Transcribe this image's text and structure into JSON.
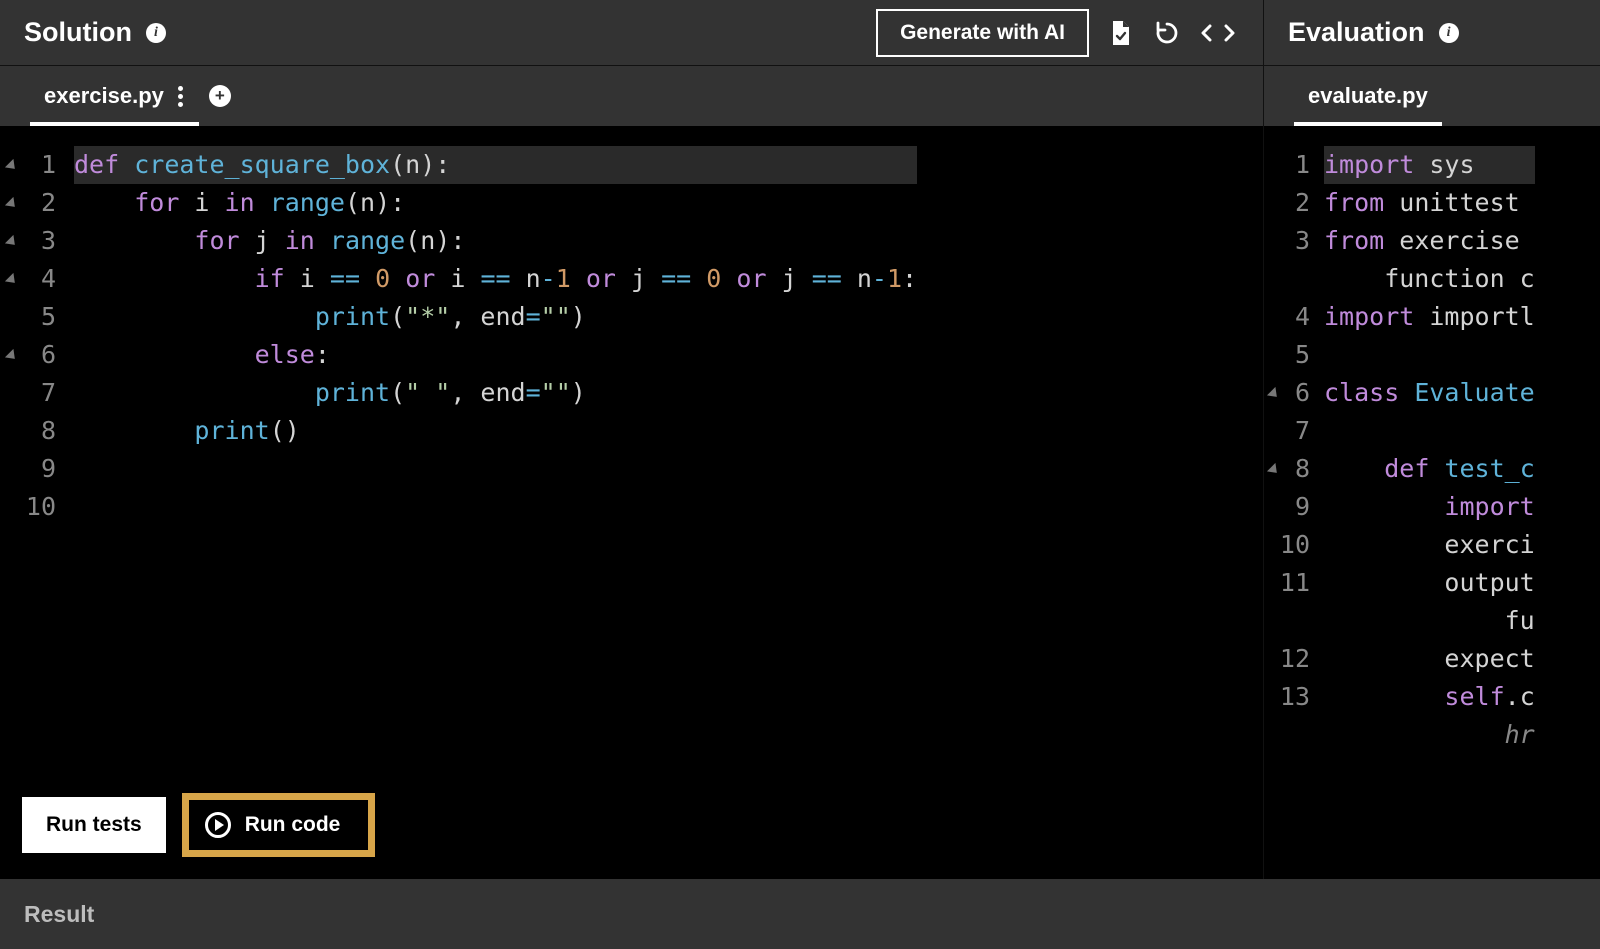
{
  "leftPanel": {
    "title": "Solution",
    "actions": {
      "generate": "Generate with AI"
    },
    "tab": "exercise.py"
  },
  "rightPanel": {
    "title": "Evaluation",
    "tab": "evaluate.py"
  },
  "buttons": {
    "runTests": "Run tests",
    "runCode": "Run code"
  },
  "result": {
    "title": "Result"
  },
  "leftCode": {
    "lines": [
      {
        "n": "1",
        "fold": true,
        "hl": true,
        "tokens": [
          [
            "kw",
            "def"
          ],
          [
            "pl",
            " "
          ],
          [
            "fn",
            "create_square_box"
          ],
          [
            "pn",
            "("
          ],
          [
            "pl",
            "n"
          ],
          [
            "pn",
            ")"
          ],
          [
            "pn",
            ":"
          ]
        ]
      },
      {
        "n": "2",
        "fold": true,
        "tokens": [
          [
            "pl",
            "    "
          ],
          [
            "kw",
            "for"
          ],
          [
            "pl",
            " i "
          ],
          [
            "kw",
            "in"
          ],
          [
            "pl",
            " "
          ],
          [
            "fn",
            "range"
          ],
          [
            "pn",
            "("
          ],
          [
            "pl",
            "n"
          ],
          [
            "pn",
            ")"
          ],
          [
            "pn",
            ":"
          ]
        ]
      },
      {
        "n": "3",
        "fold": true,
        "tokens": [
          [
            "pl",
            "        "
          ],
          [
            "kw",
            "for"
          ],
          [
            "pl",
            " j "
          ],
          [
            "kw",
            "in"
          ],
          [
            "pl",
            " "
          ],
          [
            "fn",
            "range"
          ],
          [
            "pn",
            "("
          ],
          [
            "pl",
            "n"
          ],
          [
            "pn",
            ")"
          ],
          [
            "pn",
            ":"
          ]
        ]
      },
      {
        "n": "4",
        "fold": true,
        "tokens": [
          [
            "pl",
            "            "
          ],
          [
            "kw",
            "if"
          ],
          [
            "pl",
            " i "
          ],
          [
            "op",
            "=="
          ],
          [
            "pl",
            " "
          ],
          [
            "num",
            "0"
          ],
          [
            "pl",
            " "
          ],
          [
            "kw",
            "or"
          ],
          [
            "pl",
            " i "
          ],
          [
            "op",
            "=="
          ],
          [
            "pl",
            " n"
          ],
          [
            "op",
            "-"
          ],
          [
            "num",
            "1"
          ],
          [
            "pl",
            " "
          ],
          [
            "kw",
            "or"
          ],
          [
            "pl",
            " j "
          ],
          [
            "op",
            "=="
          ],
          [
            "pl",
            " "
          ],
          [
            "num",
            "0"
          ],
          [
            "pl",
            " "
          ],
          [
            "kw",
            "or"
          ],
          [
            "pl",
            " j "
          ],
          [
            "op",
            "=="
          ],
          [
            "pl",
            " n"
          ],
          [
            "op",
            "-"
          ],
          [
            "num",
            "1"
          ],
          [
            "pn",
            ":"
          ]
        ]
      },
      {
        "n": "5",
        "tokens": [
          [
            "pl",
            "                "
          ],
          [
            "fn",
            "print"
          ],
          [
            "pn",
            "("
          ],
          [
            "str",
            "\"*\""
          ],
          [
            "pn",
            ","
          ],
          [
            "pl",
            " end"
          ],
          [
            "op",
            "="
          ],
          [
            "str",
            "\"\""
          ],
          [
            "pn",
            ")"
          ]
        ]
      },
      {
        "n": "6",
        "fold": true,
        "tokens": [
          [
            "pl",
            "            "
          ],
          [
            "kw",
            "else"
          ],
          [
            "pn",
            ":"
          ]
        ]
      },
      {
        "n": "7",
        "tokens": [
          [
            "pl",
            "                "
          ],
          [
            "fn",
            "print"
          ],
          [
            "pn",
            "("
          ],
          [
            "str",
            "\" \""
          ],
          [
            "pn",
            ","
          ],
          [
            "pl",
            " end"
          ],
          [
            "op",
            "="
          ],
          [
            "str",
            "\"\""
          ],
          [
            "pn",
            ")"
          ]
        ]
      },
      {
        "n": "8",
        "tokens": [
          [
            "pl",
            "        "
          ],
          [
            "fn",
            "print"
          ],
          [
            "pn",
            "("
          ],
          [
            "pn",
            ")"
          ]
        ]
      },
      {
        "n": "9",
        "tokens": []
      },
      {
        "n": "10",
        "tokens": []
      }
    ]
  },
  "rightCode": {
    "lines": [
      {
        "n": "1",
        "hl": true,
        "tokens": [
          [
            "kw",
            "import"
          ],
          [
            "pl",
            " sys"
          ]
        ]
      },
      {
        "n": "2",
        "tokens": [
          [
            "kw",
            "from"
          ],
          [
            "pl",
            " unittest"
          ]
        ]
      },
      {
        "n": "3",
        "tokens": [
          [
            "kw",
            "from"
          ],
          [
            "pl",
            " exercise"
          ]
        ]
      },
      {
        "n": "",
        "tokens": [
          [
            "pl",
            "    function c"
          ]
        ]
      },
      {
        "n": "4",
        "tokens": [
          [
            "kw",
            "import"
          ],
          [
            "pl",
            " importl"
          ]
        ]
      },
      {
        "n": "5",
        "tokens": []
      },
      {
        "n": "6",
        "fold": true,
        "tokens": [
          [
            "kw",
            "class"
          ],
          [
            "pl",
            " "
          ],
          [
            "fn",
            "Evaluate"
          ]
        ]
      },
      {
        "n": "7",
        "tokens": []
      },
      {
        "n": "8",
        "fold": true,
        "tokens": [
          [
            "pl",
            "    "
          ],
          [
            "kw",
            "def"
          ],
          [
            "pl",
            " "
          ],
          [
            "fn",
            "test_c"
          ]
        ]
      },
      {
        "n": "9",
        "tokens": [
          [
            "pl",
            "        "
          ],
          [
            "kw",
            "import"
          ]
        ]
      },
      {
        "n": "10",
        "tokens": [
          [
            "pl",
            "        exerci"
          ]
        ]
      },
      {
        "n": "11",
        "tokens": [
          [
            "pl",
            "        output"
          ]
        ]
      },
      {
        "n": "",
        "tokens": [
          [
            "pl",
            "            fu"
          ]
        ]
      },
      {
        "n": "12",
        "tokens": [
          [
            "pl",
            "        expect"
          ]
        ]
      },
      {
        "n": "13",
        "tokens": [
          [
            "pl",
            "        "
          ],
          [
            "kw",
            "self"
          ],
          [
            "pl",
            ".c"
          ]
        ]
      },
      {
        "n": "",
        "tokens": [
          [
            "pl",
            "            "
          ],
          [
            "cm",
            "hr"
          ]
        ]
      }
    ]
  }
}
